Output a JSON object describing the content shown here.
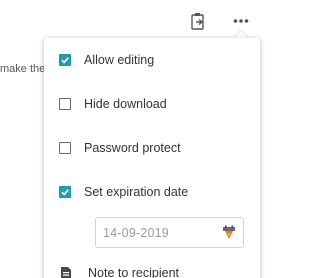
{
  "background": {
    "partial_text": "make then"
  },
  "toolbar": {
    "clipboard_icon": "clipboard-icon",
    "more_icon": "more-horizontal-icon"
  },
  "menu": {
    "items": [
      {
        "label": "Allow editing",
        "checked": true
      },
      {
        "label": "Hide download",
        "checked": false
      },
      {
        "label": "Password protect",
        "checked": false
      },
      {
        "label": "Set expiration date",
        "checked": true
      }
    ],
    "expiration_date": {
      "value": "14-09-2019",
      "icon": "calendar-icon"
    },
    "note": {
      "label": "Note to recipient",
      "icon": "note-icon"
    }
  },
  "colors": {
    "accent": "#1f9fb0",
    "text": "#333333",
    "placeholder": "#9a9a9a"
  }
}
